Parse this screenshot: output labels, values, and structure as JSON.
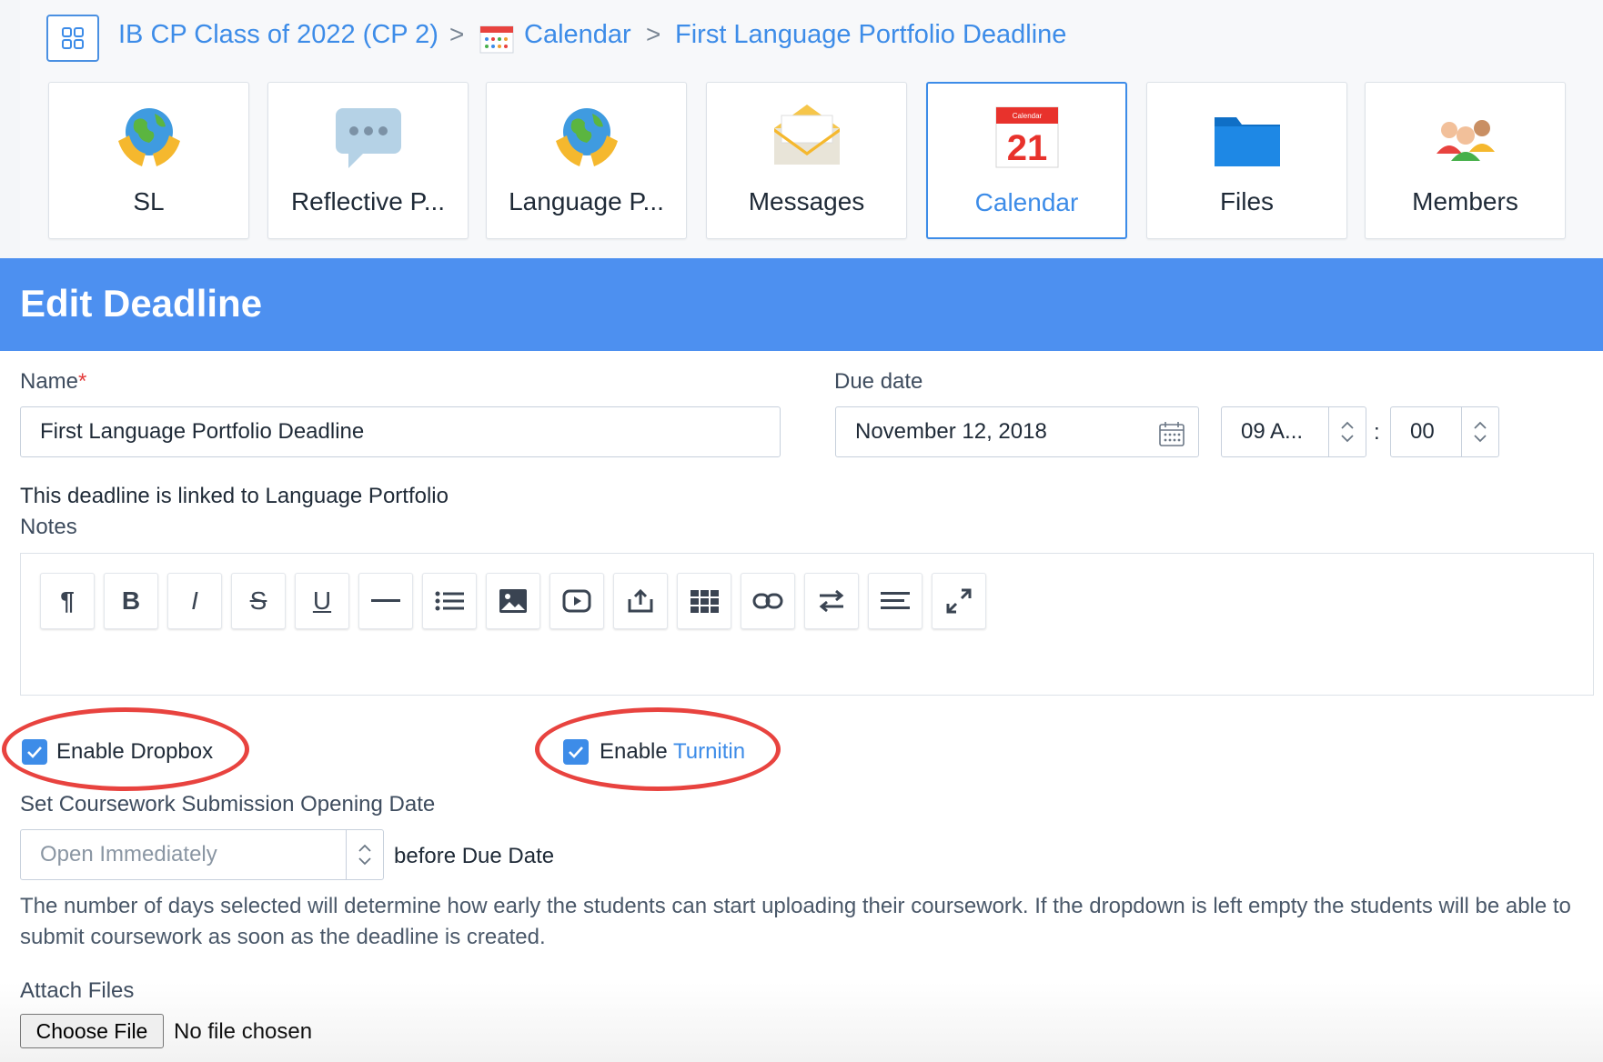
{
  "breadcrumb": {
    "class_name": "IB CP Class of 2022 (CP 2)",
    "section": "Calendar",
    "current": "First Language Portfolio Deadline",
    "separator": ">"
  },
  "tiles": [
    {
      "label": "SL",
      "icon": "globe-hands-icon"
    },
    {
      "label": "Reflective P...",
      "icon": "speech-bubble-icon"
    },
    {
      "label": "Language P...",
      "icon": "globe-hands-icon"
    },
    {
      "label": "Messages",
      "icon": "envelope-icon"
    },
    {
      "label": "Calendar",
      "icon": "calendar-icon",
      "day": "21",
      "month": "Calendar"
    },
    {
      "label": "Files",
      "icon": "folder-icon"
    },
    {
      "label": "Members",
      "icon": "people-icon"
    }
  ],
  "header": {
    "title": "Edit Deadline"
  },
  "form": {
    "name_label": "Name",
    "required_mark": "*",
    "name_value": "First Language Portfolio Deadline",
    "due_date_label": "Due date",
    "due_date_value": "November 12, 2018",
    "hour_value": "09 A...",
    "time_separator": ":",
    "minute_value": "00",
    "linked_text": "This deadline is linked to Language Portfolio",
    "notes_label": "Notes",
    "dropbox_label": "Enable Dropbox",
    "turnitin_prefix": "Enable ",
    "turnitin_link": "Turnitin",
    "opening_label": "Set Coursework Submission Opening Date",
    "opening_value": "Open Immediately",
    "opening_suffix": "before Due Date",
    "help_text": "The number of days selected will determine how early the students can start uploading their coursework. If the dropdown is left empty the students will be able to submit coursework as soon as the deadline is created.",
    "attach_label": "Attach Files",
    "choose_file": "Choose File",
    "no_file": "No file chosen"
  },
  "toolbar": {
    "paragraph": "¶",
    "bold": "B",
    "italic": "I",
    "strike": "S",
    "underline": "U"
  },
  "colors": {
    "accent": "#3d8ce8",
    "header": "#4d90f0",
    "highlight": "#e8433f"
  }
}
